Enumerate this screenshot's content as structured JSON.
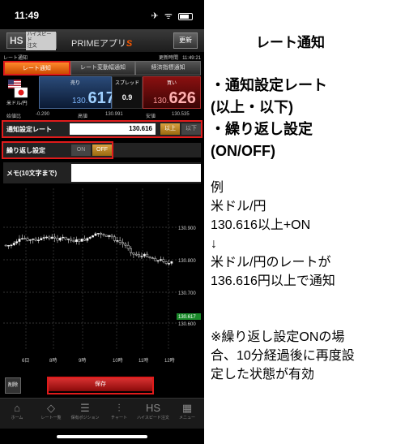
{
  "status_bar": {
    "time": "11:49",
    "icons": "✈ ᯤ"
  },
  "app_header": {
    "logo_hs": "HS",
    "logo_sub_1": "ハイスピード",
    "logo_sub_2": "注文",
    "title_prefix": "PRIMEアプリ",
    "title_suffix": "S",
    "refresh_label": "更新"
  },
  "info_bar": {
    "left": "レート通知",
    "right_label": "更新時間",
    "right_time": "11:49:21"
  },
  "tabs": [
    {
      "label": "レート通知",
      "active": true
    },
    {
      "label": "レート変動幅通知",
      "active": false
    },
    {
      "label": "経済指標通知",
      "active": false
    }
  ],
  "rate": {
    "pair": "米ドル/円",
    "sell_label": "売り",
    "sell_prefix": "130.",
    "sell_big": "617",
    "spread_label": "スプレッド",
    "spread_value": "0.9",
    "buy_label": "買い",
    "buy_prefix": "130.",
    "buy_big": "626",
    "prev_close_label": "始値比",
    "prev_close_value": "-0.290",
    "high_label": "高値",
    "high_value": "130.991",
    "low_label": "安値",
    "low_value": "130.535"
  },
  "settings": {
    "rate_label": "通知設定レート",
    "rate_value": "130.616",
    "above_label": "以上",
    "below_label": "以下",
    "repeat_label": "繰り返し設定",
    "on_label": "ON",
    "off_label": "OFF",
    "memo_label": "メモ(10文字まで)",
    "memo_value": ""
  },
  "chart_data": {
    "type": "candlestick",
    "y_ticks": [
      "130.900",
      "130.800",
      "130.700",
      "130.600"
    ],
    "x_ticks": [
      "6日",
      "8時",
      "9時",
      "10時",
      "11時",
      "12時"
    ],
    "current_price_label": "130.617"
  },
  "actions": {
    "delete_label": "削除",
    "save_label": "保存"
  },
  "bottom_nav": [
    {
      "icon": "⌂",
      "label": "ホーム",
      "icon_name": "home-icon"
    },
    {
      "icon": "◇",
      "label": "レート一覧",
      "icon_name": "rate-list-icon"
    },
    {
      "icon": "☰",
      "label": "保有ポジション",
      "icon_name": "position-icon"
    },
    {
      "icon": "⫶",
      "label": "チャート",
      "icon_name": "chart-icon"
    },
    {
      "icon": "HS",
      "label": "ハイスピード注文",
      "icon_name": "highspeed-icon"
    },
    {
      "icon": "▦",
      "label": "メニュー",
      "icon_name": "menu-icon"
    }
  ],
  "explanation": {
    "title": "レート通知",
    "bullet_1": "・通知設定レート",
    "bullet_2": "(以上・以下)",
    "bullet_3": "・繰り返し設定",
    "bullet_4": "(ON/OFF)",
    "example_lines": [
      "例",
      "米ドル/円",
      "130.616以上+ON",
      "↓",
      "米ドル/円のレートが",
      "136.616円以上で通知"
    ],
    "note_lines": [
      "※繰り返し設定ONの場",
      "合、10分経過後に再度設",
      "定した状態が有効"
    ]
  }
}
